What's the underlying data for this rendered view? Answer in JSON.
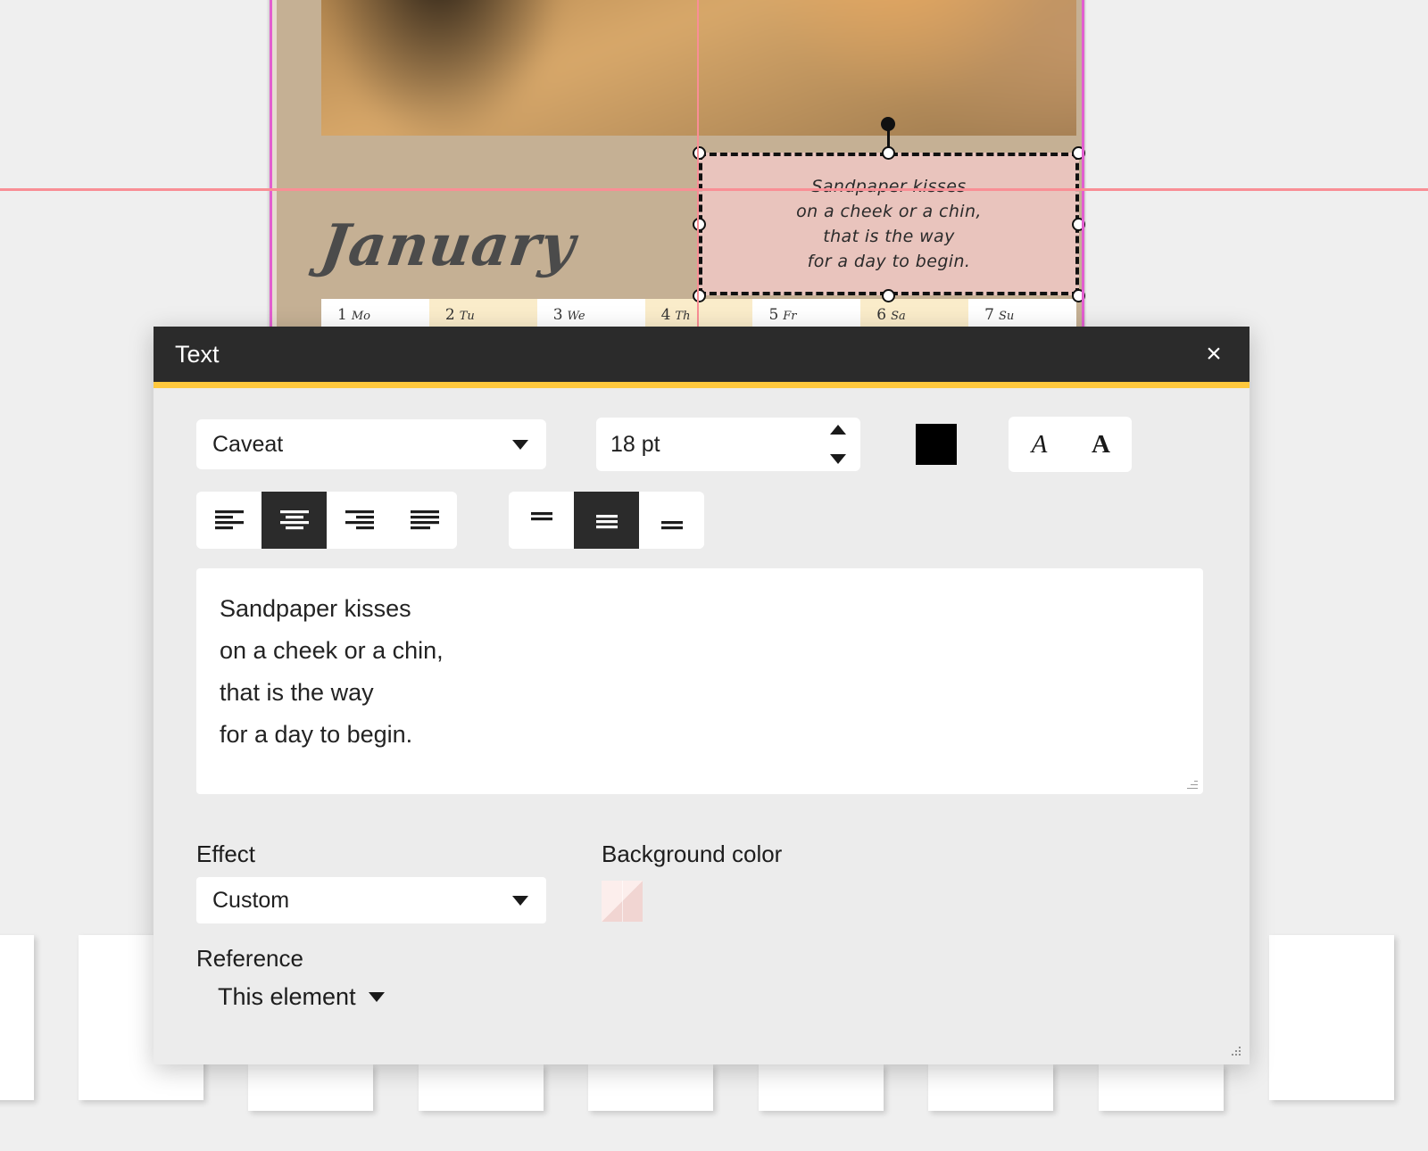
{
  "canvas": {
    "month_title": "January",
    "days": [
      {
        "num": "1",
        "abbr": "Mo",
        "alt": false
      },
      {
        "num": "2",
        "abbr": "Tu",
        "alt": true
      },
      {
        "num": "3",
        "abbr": "We",
        "alt": false
      },
      {
        "num": "4",
        "abbr": "Th",
        "alt": true
      },
      {
        "num": "5",
        "abbr": "Fr",
        "alt": false
      },
      {
        "num": "6",
        "abbr": "Sa",
        "alt": true
      },
      {
        "num": "7",
        "abbr": "Su",
        "alt": false
      }
    ],
    "selected_text_lines": [
      "Sandpaper kisses",
      "on a cheek or a chin,",
      "that is the way",
      "for a day to begin."
    ],
    "selection_fill": "#e9c4bd",
    "page_background": "#c5b094",
    "guide_vertical_color": "#e25fd0",
    "guide_horizontal_color": "#f98e95"
  },
  "dialog": {
    "title": "Text",
    "close_label": "×",
    "accent_color": "#ffc83d",
    "header_color": "#2b2b2b",
    "font": {
      "label": "font-family-select",
      "value": "Caveat"
    },
    "size": {
      "value": "18 pt"
    },
    "text_color": "#000000",
    "style_buttons": [
      {
        "name": "italic-button",
        "glyph": "A"
      },
      {
        "name": "bold-button",
        "glyph": "A"
      }
    ],
    "horizontal_align": {
      "options": [
        "left",
        "center",
        "right",
        "justify"
      ],
      "selected": "center"
    },
    "vertical_align": {
      "options": [
        "top",
        "middle",
        "bottom"
      ],
      "selected": "middle"
    },
    "textarea": {
      "lines": [
        "Sandpaper kisses",
        "on a cheek or a chin,",
        "that is the way",
        "for a day to begin."
      ],
      "placeholder": ""
    },
    "effect": {
      "label": "Effect",
      "value": "Custom"
    },
    "reference": {
      "label": "Reference",
      "value": "This element"
    },
    "background_color": {
      "label": "Background color",
      "value": "#f9dcd9"
    }
  }
}
